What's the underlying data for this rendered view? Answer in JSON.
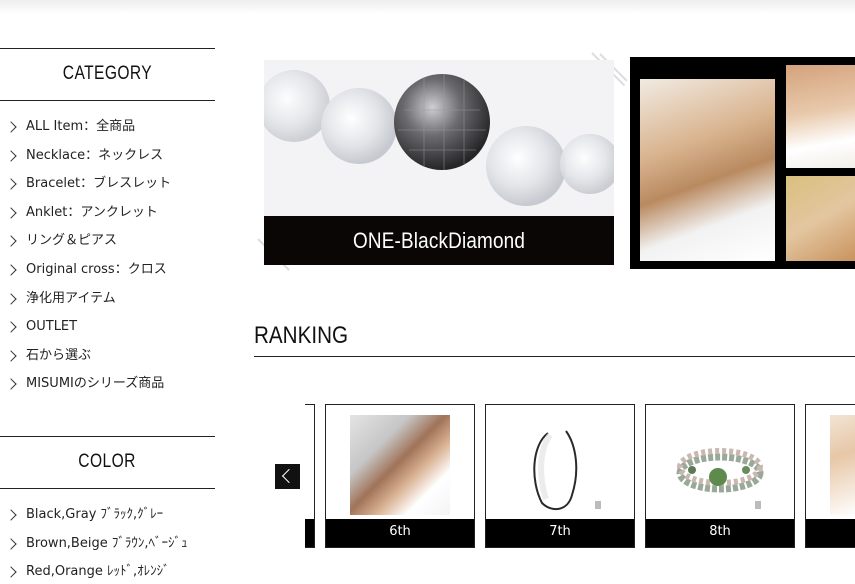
{
  "sidebar": {
    "category_title": "CATEGORY",
    "category_items": [
      {
        "label": "ALL Item：全商品"
      },
      {
        "label": "Necklace：ネックレス"
      },
      {
        "label": "Bracelet：ブレスレット"
      },
      {
        "label": "Anklet：アンクレット"
      },
      {
        "label": "リング＆ピアス"
      },
      {
        "label": "Original cross：クロス"
      },
      {
        "label": "浄化用アイテム"
      },
      {
        "label": "OUTLET"
      },
      {
        "label": "石から選ぶ"
      },
      {
        "label": "MISUMIのシリーズ商品"
      }
    ],
    "color_title": "COLOR",
    "color_items": [
      {
        "label": "Black,Gray ﾌﾞﾗｯｸ,ｸﾞﾚｰ"
      },
      {
        "label": "Brown,Beige ﾌﾞﾗｳﾝ,ﾍﾞｰｼﾞｭ"
      },
      {
        "label": "Red,Orange ﾚｯﾄﾞ,ｵﾚﾝｼﾞ"
      }
    ]
  },
  "banner": {
    "caption": "ONE-BlackDiamond"
  },
  "ranking": {
    "title": "RANKING",
    "items": [
      {
        "label": "6th"
      },
      {
        "label": "7th"
      },
      {
        "label": "8th"
      },
      {
        "label": ""
      }
    ]
  },
  "icons": {
    "chevron": "chevron-right-icon",
    "prev": "chevron-left-icon"
  }
}
